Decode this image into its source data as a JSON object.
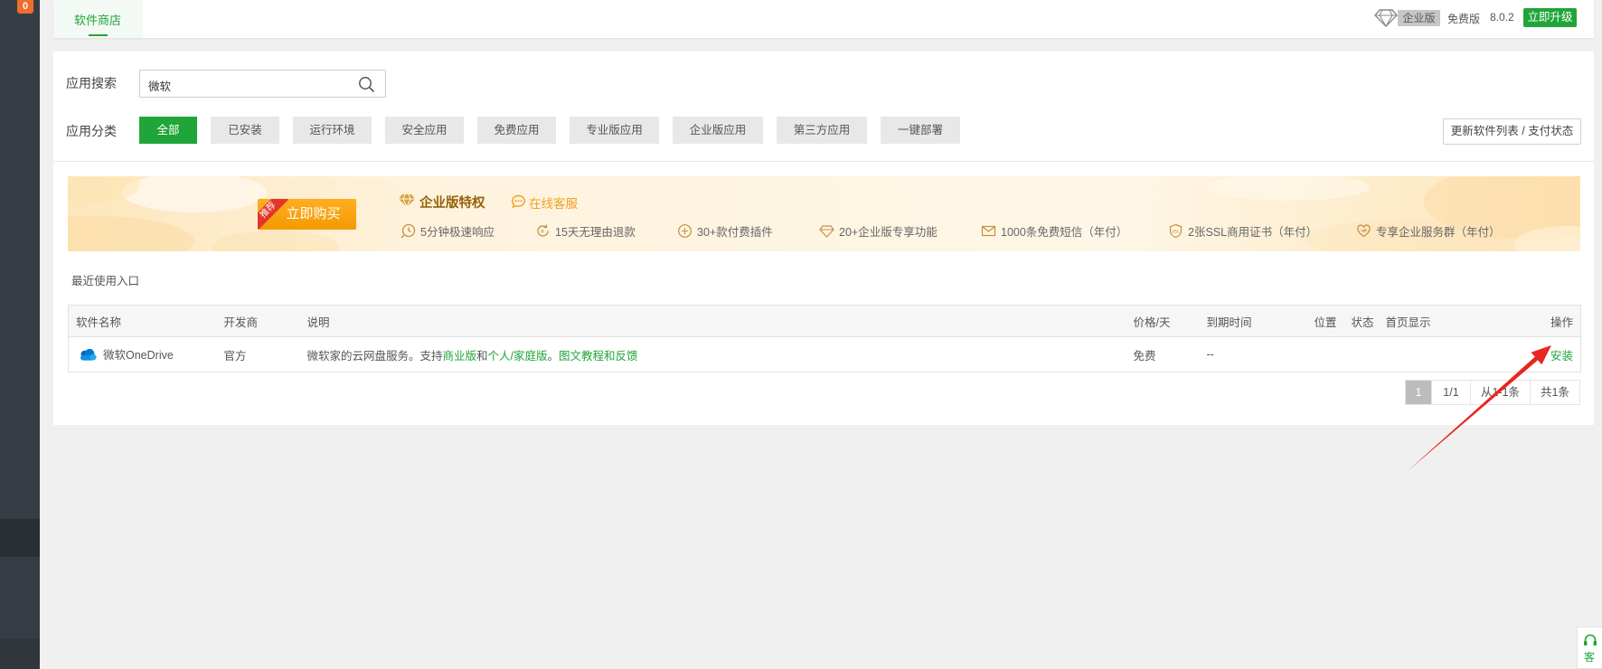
{
  "sidebar": {
    "badge": "0"
  },
  "topbar": {
    "tab": "软件商店",
    "edition_badge": "企业版",
    "free_label": "免费版",
    "version": "8.0.2",
    "upgrade_label": "立即升级"
  },
  "search": {
    "label": "应用搜索",
    "value": "微软"
  },
  "categories": {
    "label": "应用分类",
    "items": [
      "全部",
      "已安装",
      "运行环境",
      "安全应用",
      "免费应用",
      "专业版应用",
      "企业版应用",
      "第三方应用",
      "一键部署"
    ],
    "active": "全部",
    "refresh_label": "更新软件列表 / 支付状态"
  },
  "banner": {
    "ribbon": "推荐",
    "buy_label": "立即购买",
    "title": "企业版特权",
    "service_label": "在线客服",
    "features": [
      {
        "icon": "clock-icon",
        "text": "5分钟极速响应"
      },
      {
        "icon": "refund-icon",
        "text": "15天无理由退款"
      },
      {
        "icon": "plugin-icon",
        "text": "30+款付费插件"
      },
      {
        "icon": "diamond-outline-icon",
        "text": "20+企业版专享功能"
      },
      {
        "icon": "mail-icon",
        "text": "1000条免费短信（年付）"
      },
      {
        "icon": "ssl-shield-icon",
        "text": "2张SSL商用证书（年付）"
      },
      {
        "icon": "heart-icon",
        "text": "专享企业服务群（年付）"
      }
    ]
  },
  "recent_label": "最近使用入口",
  "table": {
    "columns": [
      "软件名称",
      "开发商",
      "说明",
      "价格/天",
      "到期时间",
      "位置",
      "状态",
      "首页显示",
      "操作"
    ],
    "rows": [
      {
        "icon": "onedrive-icon",
        "name": "微软OneDrive",
        "developer": "官方",
        "description": {
          "prefix": "微软家的云网盘服务。支持",
          "link1": "商业版",
          "mid": "和",
          "link2": "个人/家庭版",
          "sep": "。",
          "link3": "图文教程和反馈"
        },
        "price": "免费",
        "expiry": "--",
        "action": "安装"
      }
    ]
  },
  "pagination": {
    "current": "1",
    "pages": "1/1",
    "range": "从1-1条",
    "total": "共1条"
  },
  "float_service": {
    "icon": "headset-icon",
    "label": "客"
  },
  "colors": {
    "brand_green": "#20a53a",
    "sidebar": "#373d44",
    "page_bg": "#f0f0f0",
    "banner_button": "#f7a10b",
    "ribbon_red": "#e3362a",
    "annotation_red": "#e8261f"
  }
}
